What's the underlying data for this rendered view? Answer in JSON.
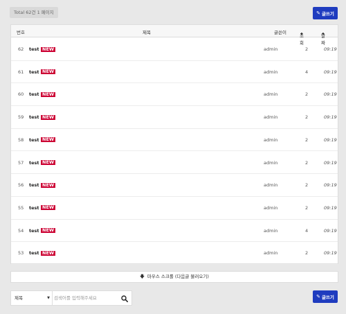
{
  "summary": {
    "total_text": "Total 62건 1 페이지"
  },
  "actions": {
    "write_label": "글쓰기"
  },
  "table": {
    "headers": {
      "num": "번호",
      "title": "제목",
      "author": "글쓴이",
      "views": "조회",
      "date": "날짜"
    },
    "rows": [
      {
        "num": "62",
        "title": "test",
        "badge": "NEW",
        "author": "admin",
        "views": "2",
        "date": "09:19"
      },
      {
        "num": "61",
        "title": "test",
        "badge": "NEW",
        "author": "admin",
        "views": "4",
        "date": "09:19"
      },
      {
        "num": "60",
        "title": "test",
        "badge": "NEW",
        "author": "admin",
        "views": "2",
        "date": "09:19"
      },
      {
        "num": "59",
        "title": "test",
        "badge": "NEW",
        "author": "admin",
        "views": "2",
        "date": "09:19"
      },
      {
        "num": "58",
        "title": "test",
        "badge": "NEW",
        "author": "admin",
        "views": "2",
        "date": "09:19"
      },
      {
        "num": "57",
        "title": "test",
        "badge": "NEW",
        "author": "admin",
        "views": "2",
        "date": "09:19"
      },
      {
        "num": "56",
        "title": "test",
        "badge": "NEW",
        "author": "admin",
        "views": "2",
        "date": "09:19"
      },
      {
        "num": "55",
        "title": "test",
        "badge": "NEW",
        "author": "admin",
        "views": "2",
        "date": "09:19"
      },
      {
        "num": "54",
        "title": "test",
        "badge": "NEW",
        "author": "admin",
        "views": "4",
        "date": "09:19"
      },
      {
        "num": "53",
        "title": "test",
        "badge": "NEW",
        "author": "admin",
        "views": "2",
        "date": "09:19"
      }
    ]
  },
  "load_more": {
    "label": "마우스 스크롤 (다음글 불러오기)"
  },
  "search": {
    "field_selected": "제목",
    "placeholder": "검색어를 입력해주세요"
  },
  "colors": {
    "accent": "#1f3cbf",
    "new_badge": "#cc0033"
  },
  "icons": {
    "write": "pencil-icon",
    "sort": "sort-icon",
    "load_more": "arrow-down-icon",
    "search": "search-icon"
  }
}
